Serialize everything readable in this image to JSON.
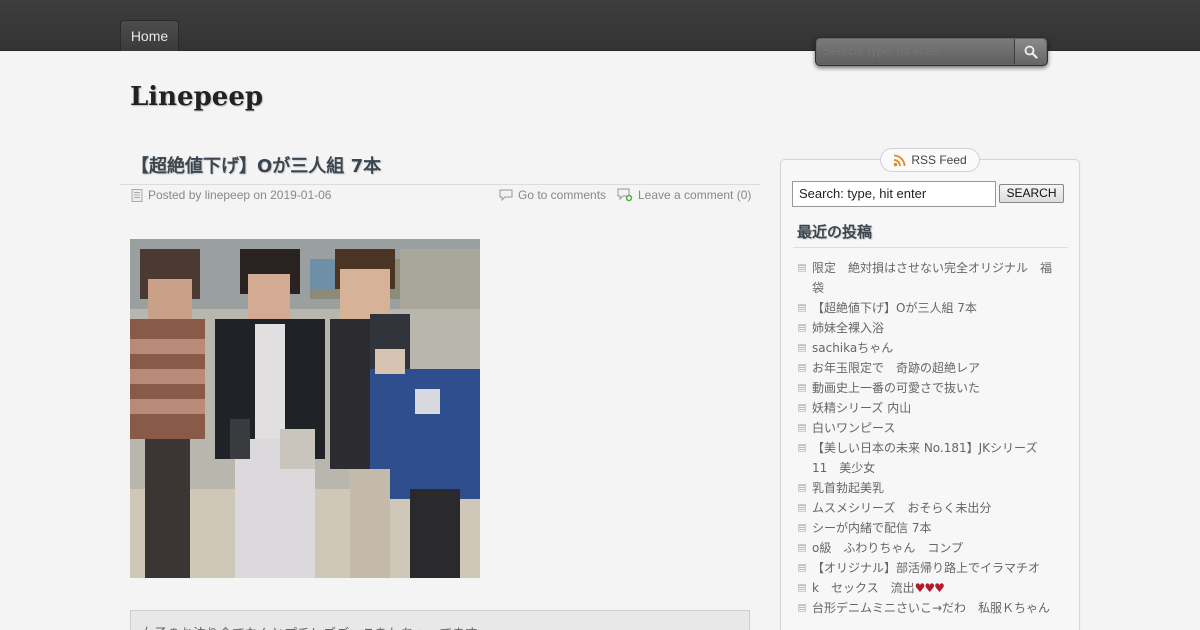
{
  "nav": {
    "home_label": "Home"
  },
  "header_search": {
    "placeholder": "Search: type, hit enter"
  },
  "site": {
    "title": "Linepeep"
  },
  "post": {
    "title": "【超絶値下げ】Oが三人組 7本",
    "posted_by": "Posted by linepeep on 2019-01-06",
    "go_to_comments": "Go to comments",
    "leave_comment": "Leave a comment (0)",
    "excerpt": "女子のお泊り会でなんとプチレズごっこをしちゃってます"
  },
  "sidebar": {
    "rss_label": "RSS Feed",
    "search_value": "Search: type, hit enter",
    "search_button": "SEARCH",
    "recent_title": "最近の投稿",
    "recent_posts": [
      {
        "text": "限定　絶対損はさせない完全オリジナル　福袋"
      },
      {
        "text": "【超絶値下げ】Oが三人組 7本"
      },
      {
        "text": "姉妹全裸入浴"
      },
      {
        "text": "sachikaちゃん"
      },
      {
        "text": "お年玉限定で　奇跡の超絶レア"
      },
      {
        "text": "動画史上一番の可愛さで抜いた"
      },
      {
        "text": "妖精シリーズ 内山"
      },
      {
        "text": "白いワンピース"
      },
      {
        "text": "【美しい日本の未来 No.181】JKシリーズ　11　美少女"
      },
      {
        "text": "乳首勃起美乳"
      },
      {
        "text": "ムスメシリーズ　おそらく未出分"
      },
      {
        "text": "シーが内緒で配信 7本"
      },
      {
        "text": "o級　ふわりちゃん　コンプ"
      },
      {
        "text": "【オリジナル】部活帰り路上でイラマチオ"
      },
      {
        "text": "k　セックス　流出",
        "suffix": "♥♥♥"
      },
      {
        "text": "台形デニムミニさいこ→だわ　私服Ｋちゃん"
      }
    ]
  },
  "icons": {
    "search": "magnifier-icon",
    "rss": "rss-icon",
    "post": "document-icon",
    "comments": "speech-bubble-icon",
    "add_comment": "comment-add-icon"
  },
  "colors": {
    "topbar": "#3a3a3a",
    "background": "#f4f4f4",
    "heart": "#b01c2e"
  }
}
